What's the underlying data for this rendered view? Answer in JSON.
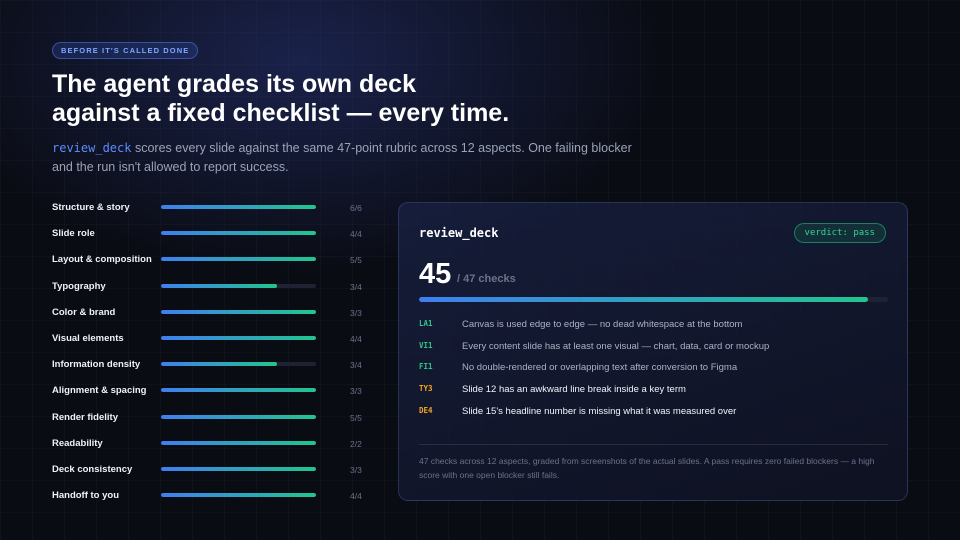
{
  "eyebrow": "BEFORE IT'S CALLED DONE",
  "headline": {
    "line1": "The agent grades its own deck",
    "line2": "against a fixed checklist — every time."
  },
  "subtitle": {
    "code": "review_deck",
    "text": " scores every slide against the same 47-point rubric across 12 aspects. One failing blocker and the run isn't allowed to report success."
  },
  "aspects": [
    {
      "label": "Structure & story",
      "score": "6/6",
      "passed": 6,
      "total": 6
    },
    {
      "label": "Slide role",
      "score": "4/4",
      "passed": 4,
      "total": 4
    },
    {
      "label": "Layout & composition",
      "score": "5/5",
      "passed": 5,
      "total": 5
    },
    {
      "label": "Typography",
      "score": "3/4",
      "passed": 3,
      "total": 4
    },
    {
      "label": "Color & brand",
      "score": "3/3",
      "passed": 3,
      "total": 3
    },
    {
      "label": "Visual elements",
      "score": "4/4",
      "passed": 4,
      "total": 4
    },
    {
      "label": "Information density",
      "score": "3/4",
      "passed": 3,
      "total": 4
    },
    {
      "label": "Alignment & spacing",
      "score": "3/3",
      "passed": 3,
      "total": 3
    },
    {
      "label": "Render fidelity",
      "score": "5/5",
      "passed": 5,
      "total": 5
    },
    {
      "label": "Readability",
      "score": "2/2",
      "passed": 2,
      "total": 2
    },
    {
      "label": "Deck consistency",
      "score": "3/3",
      "passed": 3,
      "total": 3
    },
    {
      "label": "Handoff to you",
      "score": "4/4",
      "passed": 4,
      "total": 4
    }
  ],
  "panel": {
    "title": "review_deck",
    "verdict": "verdict: pass",
    "score": "45",
    "total": "/ 47 checks",
    "score_value": 45,
    "total_value": 47,
    "checks": [
      {
        "code": "LA1",
        "text": "Canvas is used edge to edge — no dead whitespace at the bottom",
        "status": "pass"
      },
      {
        "code": "VI1",
        "text": "Every content slide has at least one visual — chart, data, card or mockup",
        "status": "pass"
      },
      {
        "code": "FI1",
        "text": "No double-rendered or overlapping text after conversion to Figma",
        "status": "pass"
      },
      {
        "code": "TY3",
        "text": "Slide 12 has an awkward line break inside a key term",
        "status": "fail"
      },
      {
        "code": "DE4",
        "text": "Slide 15's headline number is missing what it was measured over",
        "status": "fail"
      }
    ],
    "footnote": "47 checks across 12 aspects, graded from screenshots of the actual slides. A pass requires zero failed blockers — a high score with one open blocker still fails."
  },
  "colors": {
    "accent_blue": "#3f7ff0",
    "accent_green": "#22c58e",
    "pass": "#2fc48c",
    "warn": "#f5a524"
  }
}
